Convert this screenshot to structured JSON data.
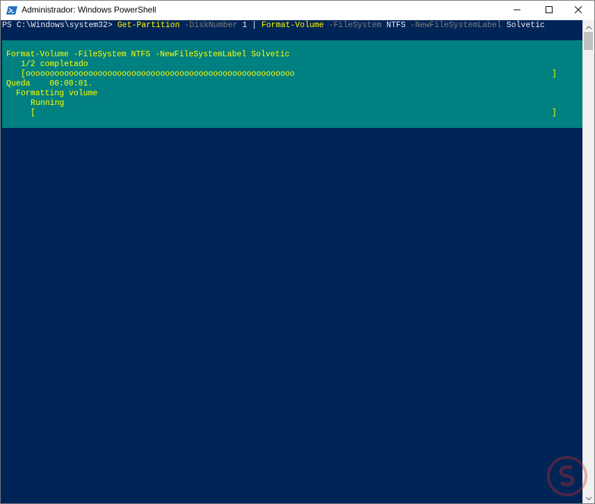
{
  "window": {
    "title": "Administrador: Windows PowerShell",
    "buttons": [
      "minimize",
      "maximize",
      "close"
    ]
  },
  "console": {
    "command": {
      "prompt": "PS C:\\Windows\\system32> ",
      "cmd1": "Get-Partition",
      "param1": " -DiskNumber",
      "arg1": " 1",
      "pipe": " | ",
      "cmd2": "Format-Volume",
      "param2": " -FileSystem",
      "arg2": " NTFS",
      "param3": " -NewFileSystemLabel",
      "arg3": " Solvetic"
    },
    "progress": {
      "activity": "Format-Volume -FileSystem NTFS -NewFileSystemLabel Solvetic",
      "status": "1/2 completado",
      "bar_open": "[",
      "bar_fill": "oooooooooooooooooooooooooooooooooooooooooooooooooooooooo",
      "bar_close": "]",
      "time_remaining": "Queda    00:00:01.",
      "sub_activity": "Formatting volume",
      "sub_status": "Running",
      "sub_bar_open": "[",
      "sub_bar_close": "]"
    }
  },
  "colors": {
    "console_bg": "#012456",
    "progress_bg": "#008080",
    "text_yellow": "#ffff00",
    "text_white": "#eeedf0",
    "text_gray": "#7f7f7f"
  },
  "icons": [
    "powershell-icon",
    "minimize-icon",
    "maximize-icon",
    "close-icon",
    "scroll-up-icon",
    "scroll-down-icon",
    "watermark-logo"
  ]
}
